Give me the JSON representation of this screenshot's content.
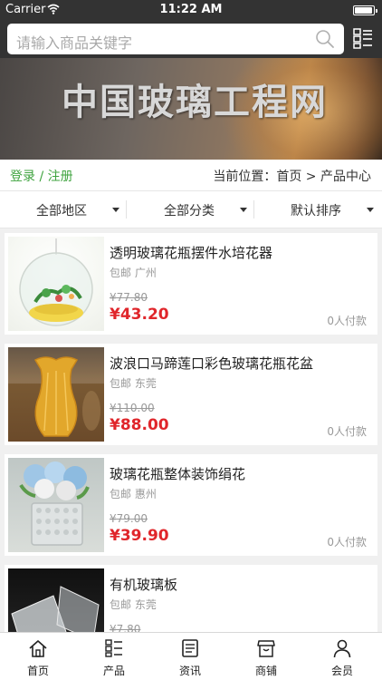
{
  "status": {
    "carrier": "Carrier",
    "time": "11:22 AM"
  },
  "search": {
    "placeholder": "请输入商品关键字"
  },
  "banner": {
    "title": "中国玻璃工程网"
  },
  "breadcrumb": {
    "login": "登录 / 注册",
    "position": "当前位置：首页 > 产品中心"
  },
  "filters": [
    {
      "label": "全部地区"
    },
    {
      "label": "全部分类"
    },
    {
      "label": "默认排序"
    }
  ],
  "products": [
    {
      "name": "透明玻璃花瓶摆件水培花器",
      "meta": "包邮 广州",
      "old_price": "¥77.80",
      "price": "¥43.20",
      "paid": "0人付款"
    },
    {
      "name": "波浪口马蹄莲口彩色玻璃花瓶花盆",
      "meta": "包邮 东莞",
      "old_price": "¥110.00",
      "price": "¥88.00",
      "paid": "0人付款"
    },
    {
      "name": "玻璃花瓶整体装饰绢花",
      "meta": "包邮 惠州",
      "old_price": "¥79.00",
      "price": "¥39.90",
      "paid": "0人付款"
    },
    {
      "name": "有机玻璃板",
      "meta": "包邮 东莞",
      "old_price": "¥7.80",
      "price": "",
      "paid": ""
    }
  ],
  "tabs": [
    {
      "label": "首页",
      "icon": "home-icon"
    },
    {
      "label": "产品",
      "icon": "grid-list-icon"
    },
    {
      "label": "资讯",
      "icon": "news-icon"
    },
    {
      "label": "商铺",
      "icon": "shop-icon"
    },
    {
      "label": "会员",
      "icon": "user-icon"
    }
  ],
  "colors": {
    "header_bg": "#333333",
    "accent_green": "#3fa33f",
    "price_red": "#e0262b"
  }
}
